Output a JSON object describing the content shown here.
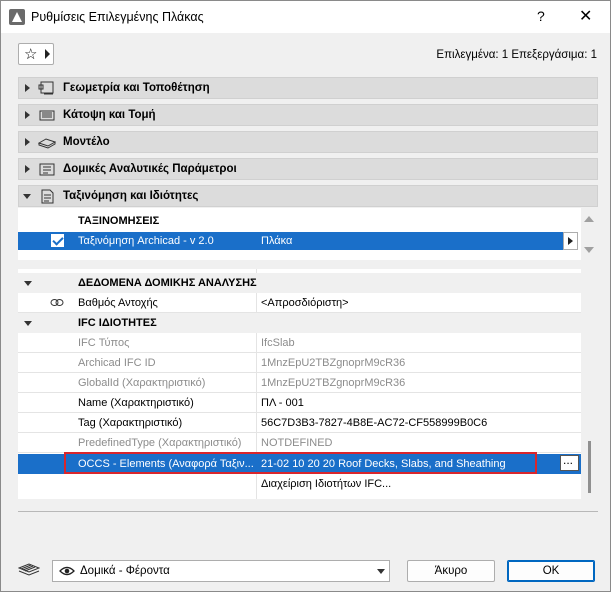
{
  "window": {
    "title": "Ρυθμίσεις Επιλεγμένης Πλάκας",
    "help_label": "?",
    "close_label": "✕"
  },
  "toolbar": {
    "selection_info": "Επιλεγμένα: 1 Επεξεργάσιμα: 1"
  },
  "panels": [
    {
      "label": "Γεωμετρία και Τοποθέτηση",
      "icon": "geometry-icon",
      "expanded": false
    },
    {
      "label": "Κάτοψη και Τομή",
      "icon": "floorplan-icon",
      "expanded": false
    },
    {
      "label": "Μοντέλο",
      "icon": "model-icon",
      "expanded": false
    },
    {
      "label": "Δομικές Αναλυτικές Παράμετροι",
      "icon": "structural-icon",
      "expanded": false
    },
    {
      "label": "Ταξινόμηση και Ιδιότητες",
      "icon": "classification-icon",
      "expanded": true
    }
  ],
  "classifications": {
    "header": "ΤΑΞΙΝΟΜΗΣΕΙΣ",
    "rows": [
      {
        "checked": true,
        "name": "Ταξινόμηση Archicad - v 2.0",
        "value": "Πλάκα"
      }
    ]
  },
  "properties": {
    "groups": [
      {
        "title": "ΔΕΔΟΜΕΝΑ ΔΟΜΙΚΗΣ ΑΝΑΛΥΣΗΣ",
        "rows": [
          {
            "label": "Βαθμός Αντοχής",
            "value": "<Απροσδιόριστη>",
            "greyed": false,
            "linked": true
          }
        ]
      },
      {
        "title": "IFC ΙΔΙΟΤΗΤΕΣ",
        "rows": [
          {
            "label": "IFC Τύπος",
            "value": "IfcSlab",
            "greyed": true
          },
          {
            "label": "Archicad IFC ID",
            "value": "1MnzEpU2TBZgnoprM9cR36",
            "greyed": true
          },
          {
            "label": "GlobalId (Χαρακτηριστικό)",
            "value": "1MnzEpU2TBZgnoprM9cR36",
            "greyed": true
          },
          {
            "label": "Name (Χαρακτηριστικό)",
            "value": "ΠΛ - 001",
            "greyed": false
          },
          {
            "label": "Tag (Χαρακτηριστικό)",
            "value": "56C7D3B3-7827-4B8E-AC72-CF558999B0C6",
            "greyed": false
          },
          {
            "label": "PredefinedType (Χαρακτηριστικό)",
            "value": "NOTDEFINED",
            "greyed": true
          },
          {
            "label": "OCCS - Elements (Αναφορά Ταξιν...",
            "value": "21-02 10 20 20 Roof Decks, Slabs, and Sheathing",
            "greyed": false,
            "selected": true
          }
        ]
      }
    ],
    "manage_label": "Διαχείριση Ιδιοτήτων IFC...",
    "dots_label": "..."
  },
  "footer": {
    "layer_value": "Δομικά - Φέροντα",
    "cancel_label": "Άκυρο",
    "ok_label": "OK"
  },
  "colors": {
    "selection": "#1a6fc9",
    "highlight_box": "#d9262c"
  }
}
